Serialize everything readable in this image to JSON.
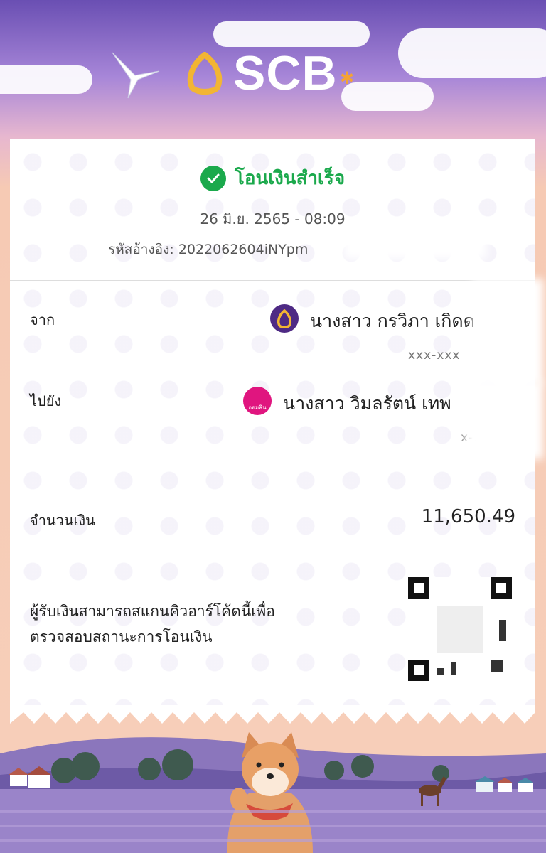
{
  "header": {
    "brand": "SCB"
  },
  "receipt": {
    "status": "โอนเงินสำเร็จ",
    "datetime": "26 มิ.ย. 2565 - 08:09",
    "reference": "รหัสอ้างอิง: 2022062604iNYpm",
    "from_label": "จาก",
    "from_name": "นางสาว กรวิภา เกิดด",
    "from_account": "xxx-xxx",
    "to_label": "ไปยัง",
    "to_name": "นางสาว วิมลรัตน์ เทพ",
    "to_account": "x-27",
    "to_bank_logo_text": "ออมสิน",
    "amount_label": "จำนวนเงิน",
    "amount_value": "11,650.49",
    "qr_note_line1": "ผู้รับเงินสามารถสแกนคิวอาร์โค้ดนี้เพื่อ",
    "qr_note_line2": "ตรวจสอบสถานะการโอนเงิน"
  },
  "colors": {
    "success": "#1ba94c",
    "scb_purple": "#4e2a84",
    "scb_gold": "#f2b533",
    "gsb_pink": "#e0157f"
  },
  "icons": {
    "status": "check-circle-icon",
    "from_bank": "scb-bank-icon",
    "to_bank": "gsb-bank-icon"
  }
}
